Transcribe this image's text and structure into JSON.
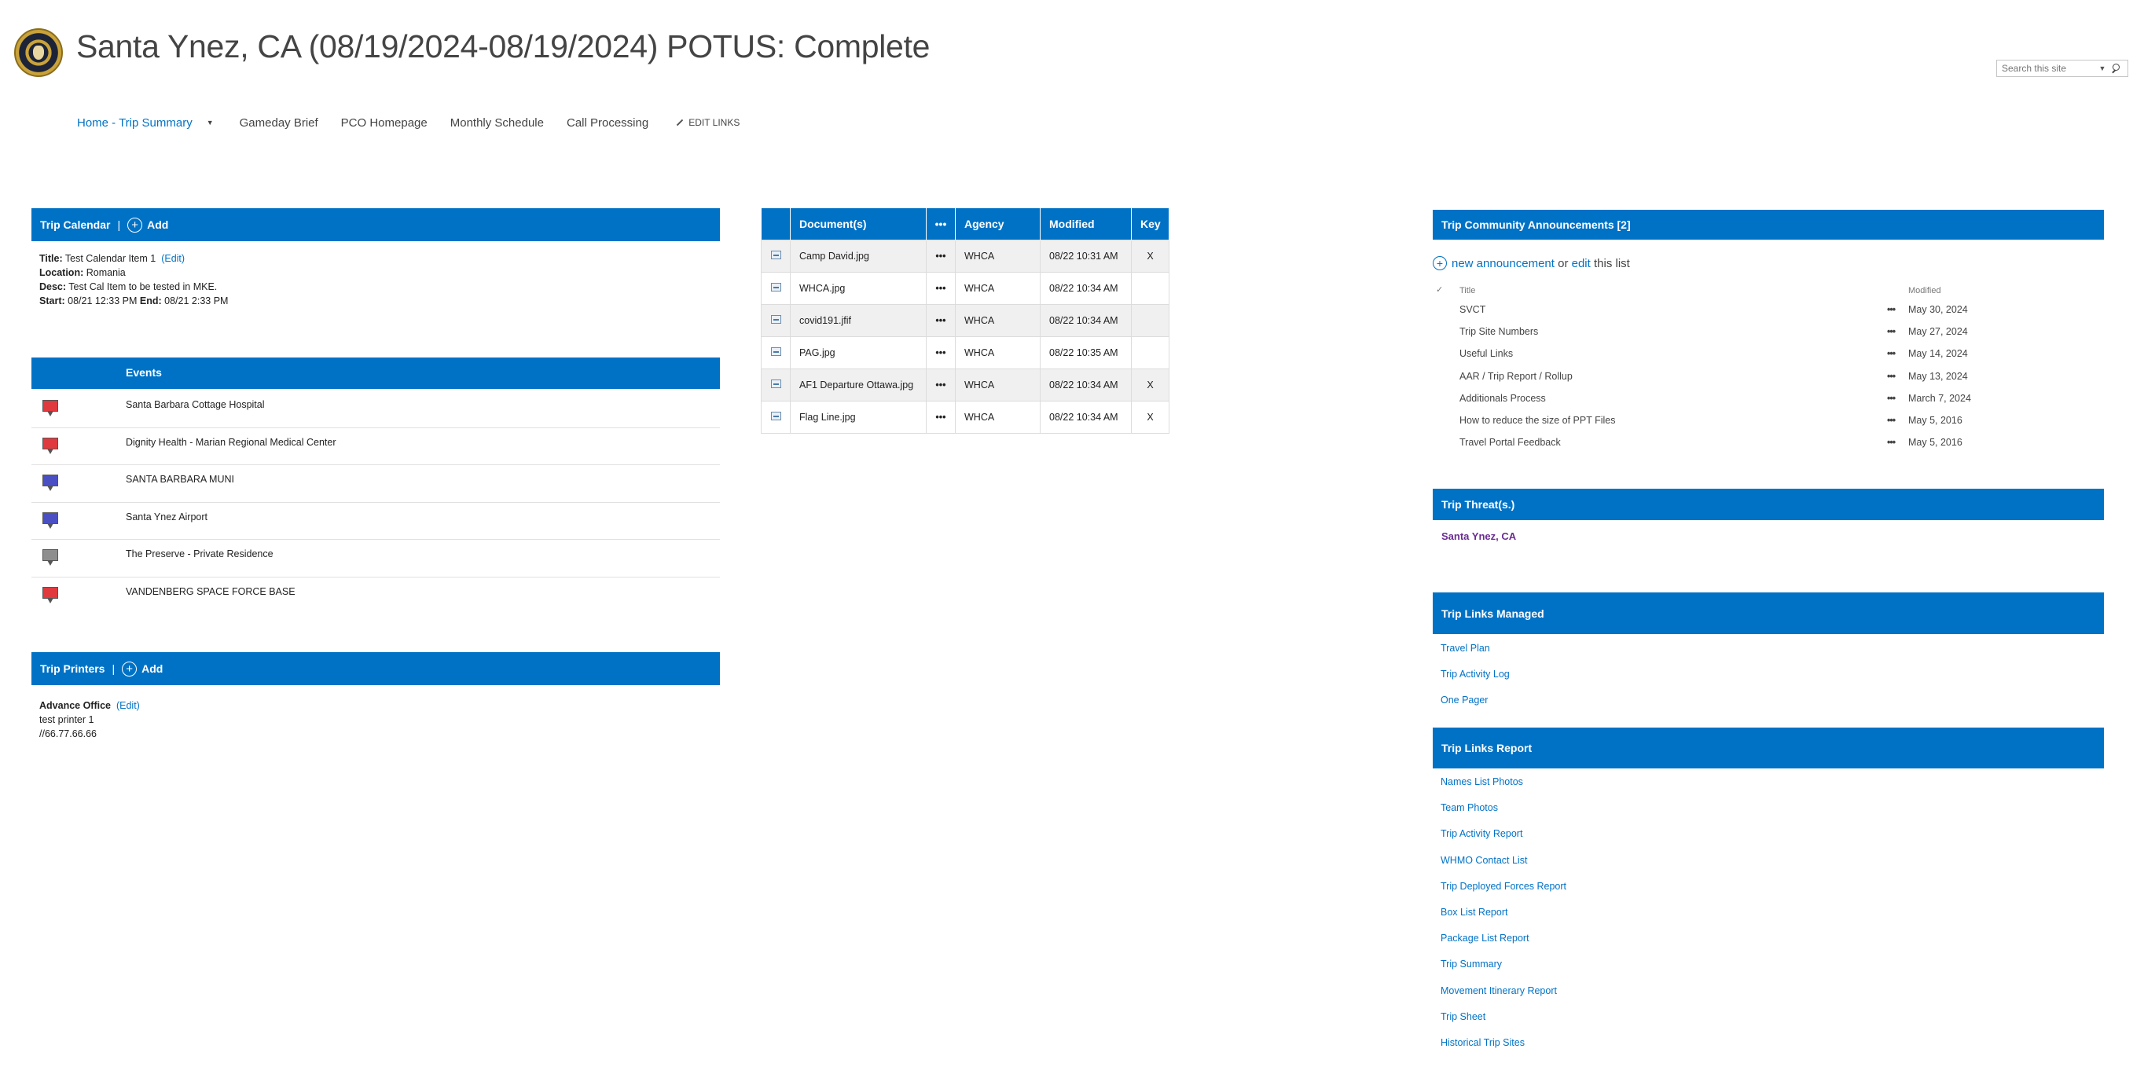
{
  "header": {
    "site_title": "Santa Ynez, CA (08/19/2024-08/19/2024) POTUS: Complete",
    "search_placeholder": "Search this site"
  },
  "nav": {
    "items": [
      "Home - Trip Summary",
      "Gameday Brief",
      "PCO Homepage",
      "Monthly Schedule",
      "Call Processing"
    ],
    "edit_links": "EDIT LINKS"
  },
  "trip_calendar": {
    "title": "Trip Calendar",
    "separator": "|",
    "add_label": "Add",
    "item": {
      "title_label": "Title:",
      "title": "Test Calendar Item 1",
      "edit_label": "(Edit)",
      "location_label": "Location:",
      "location": "Romania",
      "desc_label": "Desc:",
      "desc": "Test Cal Item to be tested in MKE.",
      "start_label": "Start:",
      "start": "08/21 12:33 PM",
      "end_label": "End:",
      "end": "08/21 2:33 PM"
    }
  },
  "events": {
    "header": "Events",
    "items": [
      {
        "label": "Santa Barbara Cottage Hospital",
        "pin_color": "#e03a3e"
      },
      {
        "label": "Dignity Health - Marian Regional Medical Center",
        "pin_color": "#e03a3e"
      },
      {
        "label": "SANTA BARBARA MUNI",
        "pin_color": "#4b4fc4"
      },
      {
        "label": "Santa Ynez Airport",
        "pin_color": "#4b4fc4"
      },
      {
        "label": "The Preserve - Private Residence",
        "pin_color": "#8e8e8e"
      },
      {
        "label": "VANDENBERG SPACE FORCE BASE",
        "pin_color": "#e03a3e"
      }
    ]
  },
  "trip_printers": {
    "title": "Trip Printers",
    "separator": "|",
    "add_label": "Add",
    "office": "Advance Office",
    "edit_label": "(Edit)",
    "printer_name": "test printer 1",
    "printer_path": "//66.77.66.66"
  },
  "documents": {
    "columns": [
      "Document(s)",
      "•••",
      "Agency",
      "Modified",
      "Key"
    ],
    "rows": [
      {
        "name": "Camp David.jpg",
        "dots": "•••",
        "agency": "WHCA",
        "modified": "08/22 10:31 AM",
        "key": "X"
      },
      {
        "name": "WHCA.jpg",
        "dots": "•••",
        "agency": "WHCA",
        "modified": "08/22 10:34 AM",
        "key": ""
      },
      {
        "name": "covid191.jfif",
        "dots": "•••",
        "agency": "WHCA",
        "modified": "08/22 10:34 AM",
        "key": ""
      },
      {
        "name": "PAG.jpg",
        "dots": "•••",
        "agency": "WHCA",
        "modified": "08/22 10:35 AM",
        "key": ""
      },
      {
        "name": "AF1 Departure Ottawa.jpg",
        "dots": "•••",
        "agency": "WHCA",
        "modified": "08/22 10:34 AM",
        "key": "X"
      },
      {
        "name": "Flag Line.jpg",
        "dots": "•••",
        "agency": "WHCA",
        "modified": "08/22 10:34 AM",
        "key": "X"
      }
    ]
  },
  "announcements": {
    "title": "Trip Community Announcements [2]",
    "new_label": "new announcement",
    "or_text": "or",
    "edit_label": "edit",
    "this_list_text": "this list",
    "check_mark": "✓",
    "col_title": "Title",
    "col_modified": "Modified",
    "dots": "•••",
    "items": [
      {
        "title": "SVCT",
        "modified": "May 30, 2024"
      },
      {
        "title": "Trip Site Numbers",
        "modified": "May 27, 2024"
      },
      {
        "title": "Useful Links",
        "modified": "May 14, 2024"
      },
      {
        "title": "AAR / Trip Report / Rollup",
        "modified": "May 13, 2024"
      },
      {
        "title": "Additionals Process",
        "modified": "March 7, 2024"
      },
      {
        "title": "How to reduce the size of PPT Files",
        "modified": "May 5, 2016"
      },
      {
        "title": "Travel Portal Feedback",
        "modified": "May 5, 2016"
      }
    ]
  },
  "trip_threats": {
    "title": "Trip Threat(s.)",
    "item": "Santa Ynez, CA"
  },
  "links_managed": {
    "title": "Trip Links Managed",
    "items": [
      "Travel Plan",
      "Trip Activity Log",
      "One Pager"
    ]
  },
  "links_report": {
    "title": "Trip Links Report",
    "items": [
      "Names List Photos",
      "Team Photos",
      "Trip Activity Report",
      "WHMO Contact List",
      "Trip Deployed Forces Report",
      "Box List Report",
      "Package List Report",
      "Trip Summary",
      "Movement Itinerary Report",
      "Trip Sheet",
      "Historical Trip Sites"
    ]
  },
  "colors": {
    "brand_blue": "#0072c6",
    "threat_purple": "#6a2c91"
  }
}
